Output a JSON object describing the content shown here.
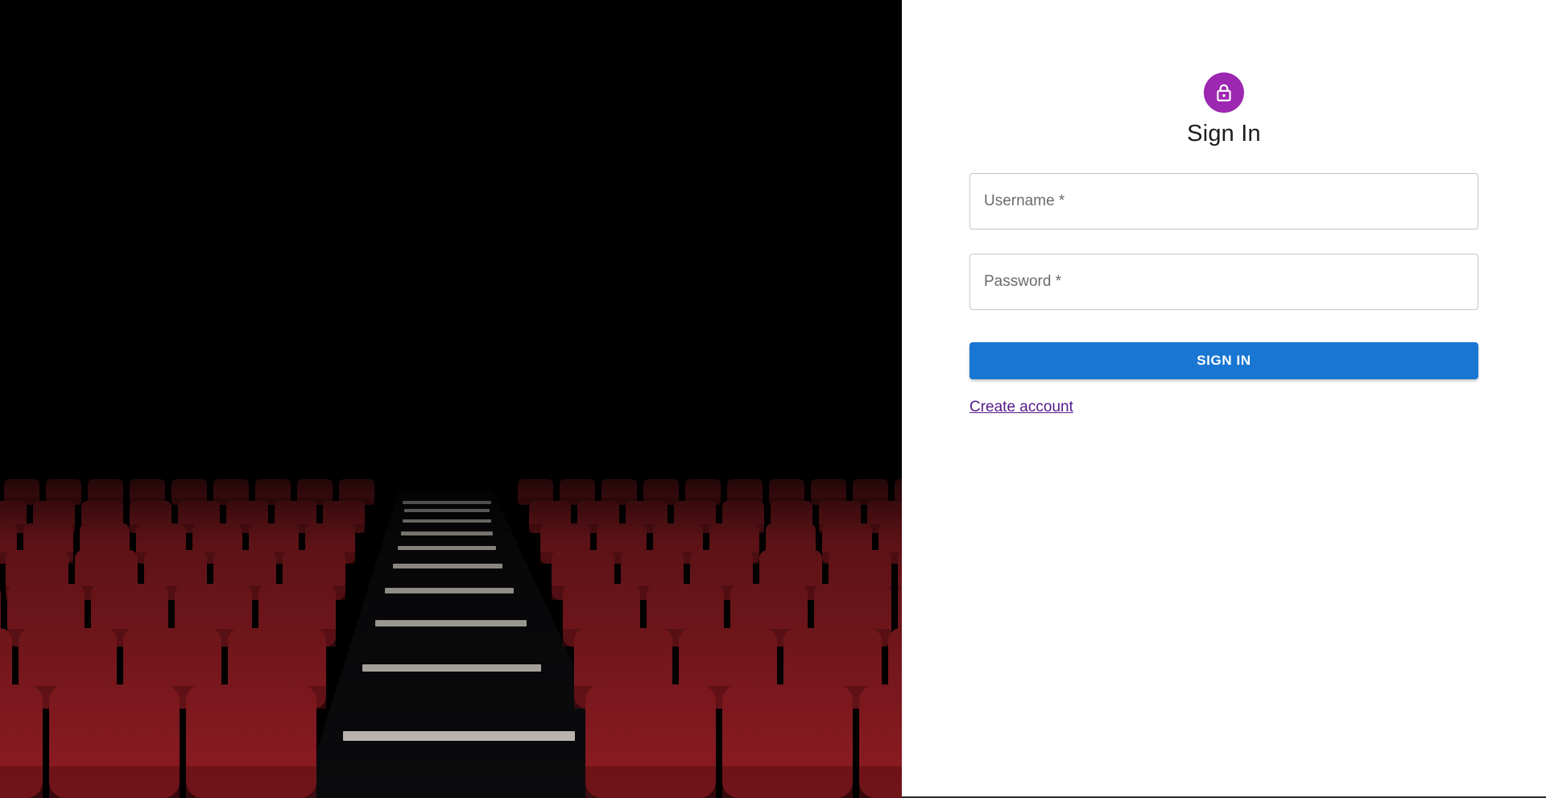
{
  "hero": {
    "image_subject": "empty-cinema-seats",
    "colors": {
      "background": "#000000",
      "seat": "#8e1c22",
      "seat_shadow": "#5e0f14",
      "step": "#c9c4bc"
    }
  },
  "signin": {
    "icon": "lock-icon",
    "icon_bg_color": "#9c27b0",
    "title": "Sign In",
    "username": {
      "label": "Username *",
      "value": ""
    },
    "password": {
      "label": "Password *",
      "value": ""
    },
    "submit_label": "SIGN IN",
    "submit_color": "#1976d2",
    "create_account_label": "Create account",
    "link_color": "#551a8b"
  }
}
